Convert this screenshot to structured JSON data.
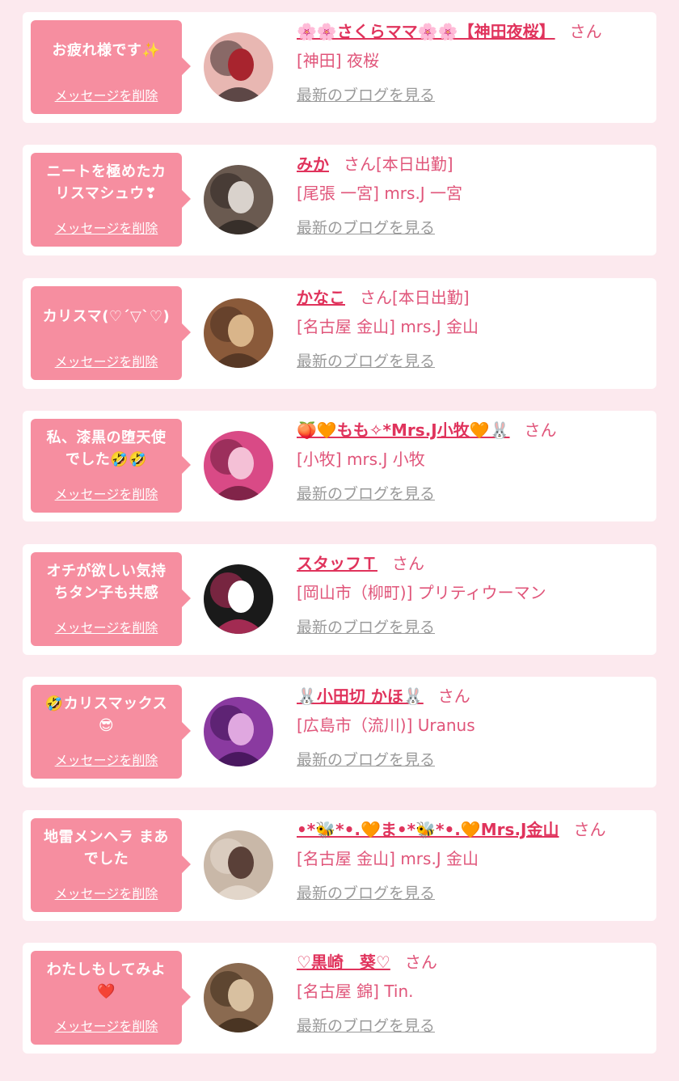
{
  "actions": {
    "delete_label": "メッセージを削除",
    "blog_label": "最新のブログを見る"
  },
  "cards": [
    {
      "message": "お疲れ様です✨",
      "name": "🌸🌸さくらママ🌸🌸【神田夜桜】",
      "suffix": "さん",
      "shop": "[神田] 夜桜",
      "avatar_colors": [
        "#e8b7b2",
        "#a8242e",
        "#3a2a2a"
      ]
    },
    {
      "message": "ニートを極めたカ\nリスマシュウ❣",
      "name": "みか",
      "suffix": "さん[本日出勤]",
      "shop": "[尾張 一宮] mrs.J 一宮",
      "avatar_colors": [
        "#6a5a50",
        "#d9d2cc",
        "#2b2420"
      ]
    },
    {
      "message": "カリスマ(♡´▽`♡)",
      "name": "かなこ",
      "suffix": "さん[本日出勤]",
      "shop": "[名古屋 金山] mrs.J 金山",
      "avatar_colors": [
        "#8a5a3a",
        "#d9b58a",
        "#4a3020"
      ]
    },
    {
      "message": "私、漆黒の堕天使\nでした🤣🤣",
      "name": "🍑🧡もも✧*Mrs.J小牧🧡🐰",
      "suffix": "さん",
      "shop": "[小牧] mrs.J 小牧",
      "avatar_colors": [
        "#d94a86",
        "#f4c0d6",
        "#6a1a3a"
      ]
    },
    {
      "message": "オチが欲しい気持\nちタン子も共感",
      "name": "スタッフＴ",
      "suffix": "さん",
      "shop": "[岡山市（柳町)] プリティウーマン",
      "avatar_colors": [
        "#1a1a1a",
        "#ffffff",
        "#c43060"
      ]
    },
    {
      "message": "🤣カリスマックス\n😎",
      "name": "🐰小田切 かほ🐰",
      "suffix": "さん",
      "shop": "[広島市（流川)] Uranus",
      "avatar_colors": [
        "#8a3aa0",
        "#e0a8e0",
        "#3a1050"
      ]
    },
    {
      "message": "地雷メンヘラ まあ\nでした",
      "name": "•*🐝*•.🧡ま•*🐝*•.🧡Mrs.J金山",
      "suffix": "さん",
      "shop": "[名古屋 金山] mrs.J 金山",
      "avatar_colors": [
        "#c9b8a8",
        "#5a4038",
        "#e8ddd2"
      ]
    },
    {
      "message": "わたしもしてみよ\n❤️",
      "name": "♡黒崎　葵♡",
      "suffix": "さん",
      "shop": "[名古屋 錦] Tin.",
      "avatar_colors": [
        "#8a6a50",
        "#d8c0a0",
        "#3a2818"
      ]
    }
  ]
}
